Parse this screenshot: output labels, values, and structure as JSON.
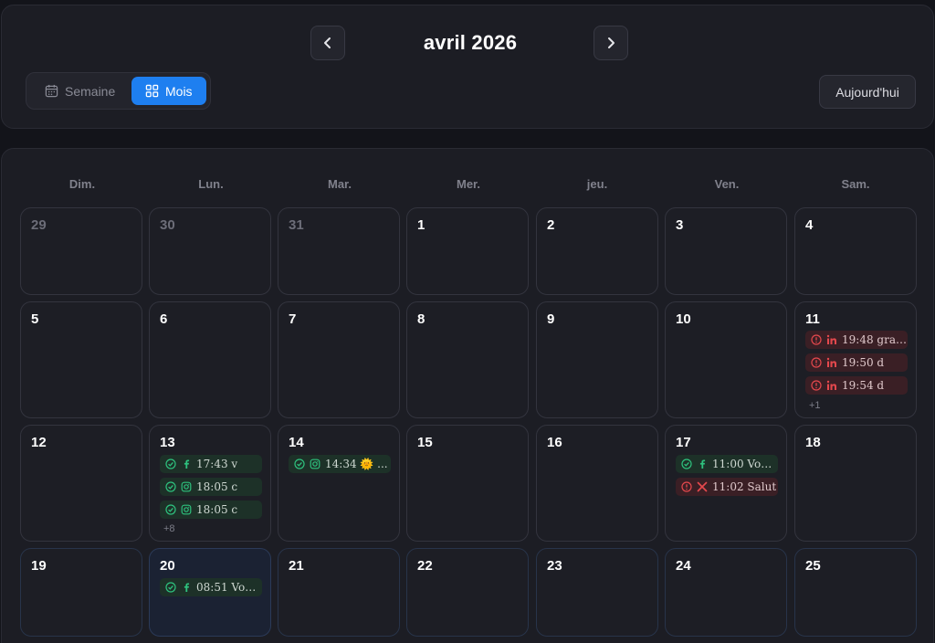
{
  "header": {
    "month_title": "avril 2026",
    "prev_icon": "chevron-left-icon",
    "next_icon": "chevron-right-icon",
    "view_week_label": "Semaine",
    "view_month_label": "Mois",
    "today_label": "Aujourd'hui"
  },
  "weekdays": [
    "Dim.",
    "Lun.",
    "Mar.",
    "Mer.",
    "jeu.",
    "Ven.",
    "Sam."
  ],
  "weeks": [
    [
      "29",
      "30",
      "31",
      "1",
      "2",
      "3",
      "4"
    ],
    [
      "5",
      "6",
      "7",
      "8",
      "9",
      "10",
      "11"
    ],
    [
      "12",
      "13",
      "14",
      "15",
      "16",
      "17",
      "18"
    ],
    [
      "19",
      "20",
      "21",
      "22",
      "23",
      "24",
      "25"
    ]
  ],
  "events": {
    "d11": [
      {
        "text": "19:48 grat...",
        "status": "error",
        "platform": "linkedin-icon"
      },
      {
        "text": "19:50 d",
        "status": "error",
        "platform": "linkedin-icon"
      },
      {
        "text": "19:54 d",
        "status": "error",
        "platform": "linkedin-icon"
      }
    ],
    "d11_more": "+1",
    "d13": [
      {
        "text": "17:43 v",
        "status": "ok",
        "platform": "facebook-icon"
      },
      {
        "text": "18:05 c",
        "status": "ok",
        "platform": "instagram-icon"
      },
      {
        "text": "18:05 c",
        "status": "ok",
        "platform": "instagram-icon"
      }
    ],
    "d13_more": "+8",
    "d14": [
      {
        "text": "14:34 🌞 ...",
        "status": "ok",
        "platform": "instagram-icon"
      }
    ],
    "d17": [
      {
        "text": "11:00 Vou...",
        "status": "ok",
        "platform": "facebook-icon"
      },
      {
        "text": "11:02 Salut",
        "status": "error",
        "platform": "x-icon"
      }
    ],
    "d20": [
      {
        "text": "08:51 Vou...",
        "status": "ok",
        "platform": "facebook-icon"
      }
    ]
  },
  "colors": {
    "accent": "#1e7ff0",
    "ok": "#2ec27e",
    "error": "#e5484d"
  }
}
